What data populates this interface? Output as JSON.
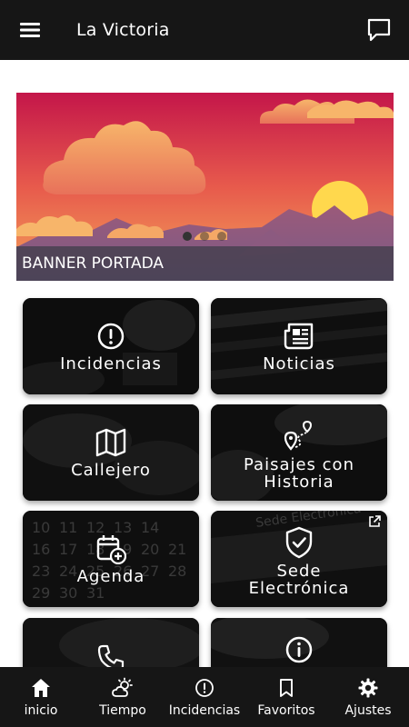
{
  "header": {
    "title": "La Victoria",
    "menu_icon": "hamburger-menu-icon",
    "chat_icon": "chat-bubble-icon"
  },
  "banner": {
    "caption": "BANNER PORTADA",
    "slide_count": 3,
    "active_slide": 1,
    "colors": {
      "sky_top": "#c4164a",
      "sky_bottom": "#f3a25a",
      "sun": "#ffd84d"
    }
  },
  "tiles": [
    {
      "id": "incidencias",
      "label": "Incidencias",
      "icon": "alert-circle-icon"
    },
    {
      "id": "noticias",
      "label": "Noticias",
      "icon": "newspaper-icon"
    },
    {
      "id": "callejero",
      "label": "Callejero",
      "icon": "map-icon"
    },
    {
      "id": "paisajes",
      "label": "Paisajes con Historia",
      "icon": "route-pin-icon"
    },
    {
      "id": "agenda",
      "label": "Agenda",
      "icon": "calendar-add-icon"
    },
    {
      "id": "sede",
      "label": "Sede Electrónica",
      "icon": "shield-check-icon",
      "external_icon": "external-link-icon"
    },
    {
      "id": "telefonos",
      "label": "",
      "icon": "phone-icon"
    },
    {
      "id": "informacion",
      "label": "",
      "icon": "info-circle-icon"
    }
  ],
  "bottom_nav": [
    {
      "label": "inicio",
      "icon": "home-icon"
    },
    {
      "label": "Tiempo",
      "icon": "weather-icon"
    },
    {
      "label": "Incidencias",
      "icon": "alert-circle-icon"
    },
    {
      "label": "Favoritos",
      "icon": "bookmark-icon"
    },
    {
      "label": "Ajustes",
      "icon": "gear-icon"
    }
  ]
}
